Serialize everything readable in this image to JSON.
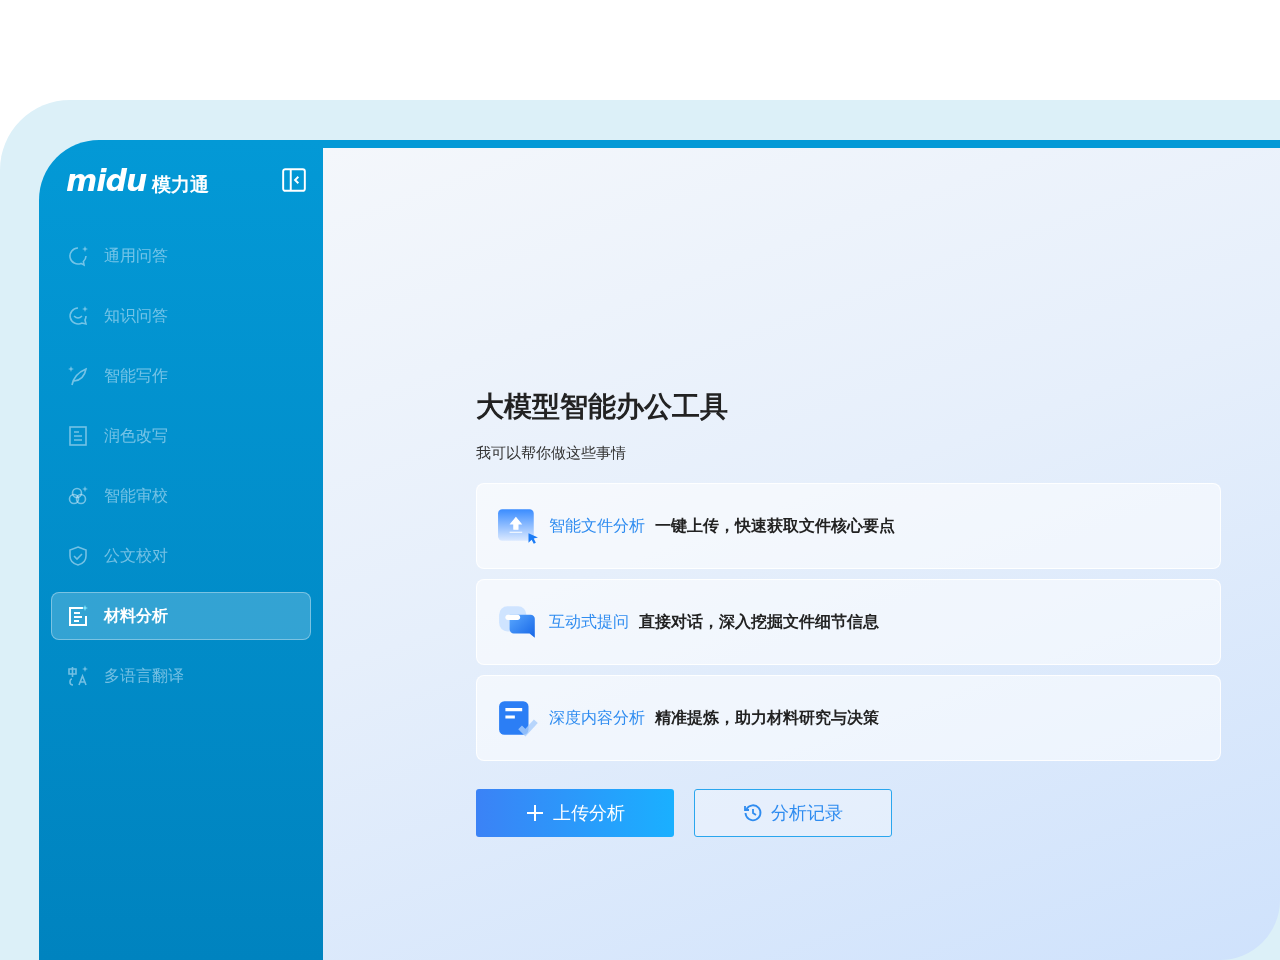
{
  "logo": {
    "wordmark": "midu",
    "name": "模力通"
  },
  "sidebar": {
    "items": [
      {
        "label": "通用问答",
        "selected": false
      },
      {
        "label": "知识问答",
        "selected": false
      },
      {
        "label": "智能写作",
        "selected": false
      },
      {
        "label": "润色改写",
        "selected": false
      },
      {
        "label": "智能审校",
        "selected": false
      },
      {
        "label": "公文校对",
        "selected": false
      },
      {
        "label": "材料分析",
        "selected": true
      },
      {
        "label": "多语言翻译",
        "selected": false
      }
    ]
  },
  "main": {
    "title": "大模型智能办公工具",
    "subtitle": "我可以帮你做这些事情",
    "features": [
      {
        "title": "智能文件分析",
        "description": "一键上传，快速获取文件核心要点"
      },
      {
        "title": "互动式提问",
        "description": "直接对话，深入挖掘文件细节信息"
      },
      {
        "title": "深度内容分析",
        "description": "精准提炼，助力材料研究与决策"
      }
    ],
    "buttons": [
      {
        "label": "上传分析",
        "kind": "primary"
      },
      {
        "label": "分析记录",
        "kind": "outline"
      }
    ]
  }
}
